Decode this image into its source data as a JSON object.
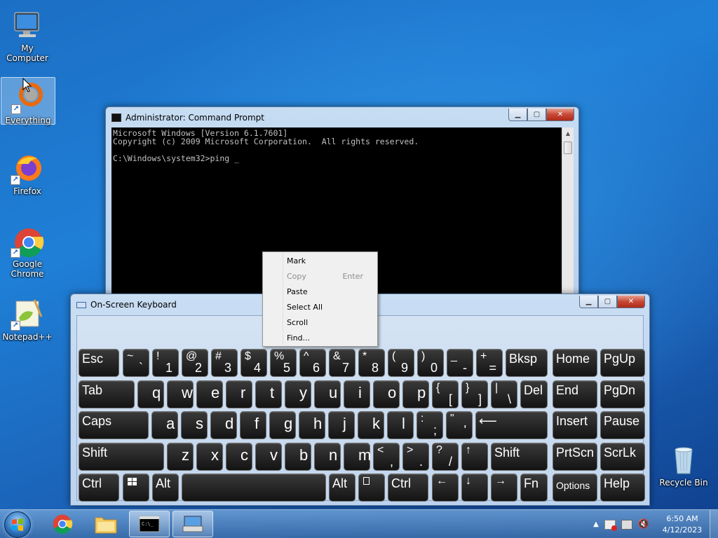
{
  "desktop": {
    "icons": [
      {
        "label": "My Computer"
      },
      {
        "label": "Everything"
      },
      {
        "label": "Firefox"
      },
      {
        "label": "Google Chrome"
      },
      {
        "label": "Notepad++"
      },
      {
        "label": "Recycle Bin"
      }
    ]
  },
  "cmd": {
    "title": "Administrator: Command Prompt",
    "line1": "Microsoft Windows [Version 6.1.7601]",
    "line2": "Copyright (c) 2009 Microsoft Corporation.  All rights reserved.",
    "line3": "C:\\Windows\\system32>ping _"
  },
  "context_menu": {
    "items": [
      {
        "label": "Mark"
      },
      {
        "label": "Copy",
        "accel": "Enter"
      },
      {
        "label": "Paste"
      },
      {
        "label": "Select All"
      },
      {
        "label": "Scroll"
      },
      {
        "label": "Find..."
      }
    ]
  },
  "osk": {
    "title": "On-Screen Keyboard",
    "keys": {
      "esc": "Esc",
      "bksp": "Bksp",
      "home": "Home",
      "pgup": "PgUp",
      "tab": "Tab",
      "del": "Del",
      "end": "End",
      "pgdn": "PgDn",
      "caps": "Caps",
      "insert": "Insert",
      "pause": "Pause",
      "shift": "Shift",
      "prtscn": "PrtScn",
      "scrlk": "ScrLk",
      "ctrl": "Ctrl",
      "alt": "Alt",
      "fn": "Fn",
      "options": "Options",
      "help": "Help",
      "num_row": [
        {
          "top": "~",
          "bot": "`"
        },
        {
          "top": "!",
          "bot": "1"
        },
        {
          "top": "@",
          "bot": "2"
        },
        {
          "top": "#",
          "bot": "3"
        },
        {
          "top": "$",
          "bot": "4"
        },
        {
          "top": "%",
          "bot": "5"
        },
        {
          "top": "^",
          "bot": "6"
        },
        {
          "top": "&",
          "bot": "7"
        },
        {
          "top": "*",
          "bot": "8"
        },
        {
          "top": "(",
          "bot": "9"
        },
        {
          "top": ")",
          "bot": "0"
        },
        {
          "top": "_",
          "bot": "-"
        },
        {
          "top": "+",
          "bot": "="
        }
      ],
      "q_row": [
        "q",
        "w",
        "e",
        "r",
        "t",
        "y",
        "u",
        "i",
        "o",
        "p"
      ],
      "q_row_sym": [
        {
          "top": "{",
          "bot": "["
        },
        {
          "top": "}",
          "bot": "]"
        },
        {
          "top": "|",
          "bot": "\\"
        }
      ],
      "a_row": [
        "a",
        "s",
        "d",
        "f",
        "g",
        "h",
        "j",
        "k",
        "l"
      ],
      "a_row_sym": [
        {
          "top": ":",
          "bot": ";"
        },
        {
          "top": "\"",
          "bot": "'"
        }
      ],
      "enter": "⟵",
      "z_row": [
        "z",
        "x",
        "c",
        "v",
        "b",
        "n",
        "m"
      ],
      "z_row_sym": [
        {
          "top": "<",
          "bot": ","
        },
        {
          "top": ">",
          "bot": "."
        },
        {
          "top": "?",
          "bot": "/"
        }
      ],
      "up": "↑",
      "down": "↓",
      "left": "←",
      "right": "→"
    }
  },
  "taskbar": {
    "time": "6:50 AM",
    "date": "4/12/2023"
  }
}
